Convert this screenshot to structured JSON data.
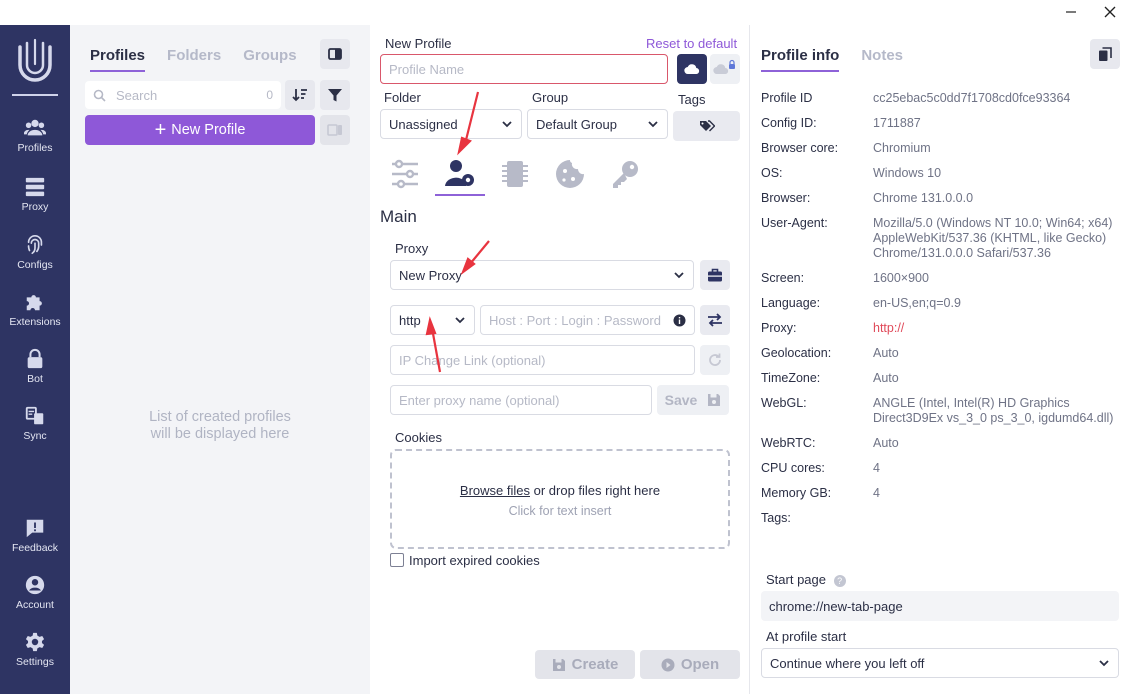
{
  "window": {
    "minimize_icon": "minimize-icon",
    "close_icon": "close-icon"
  },
  "nav": {
    "items": [
      {
        "label": "Profiles",
        "icon": "users-icon"
      },
      {
        "label": "Proxy",
        "icon": "server-icon"
      },
      {
        "label": "Configs",
        "icon": "fingerprint-icon"
      },
      {
        "label": "Extensions",
        "icon": "puzzle-icon"
      },
      {
        "label": "Bot",
        "icon": "lock-icon"
      },
      {
        "label": "Sync",
        "icon": "sync-icon"
      },
      {
        "label": "Feedback",
        "icon": "feedback-icon"
      },
      {
        "label": "Account",
        "icon": "account-icon"
      },
      {
        "label": "Settings",
        "icon": "settings-icon"
      }
    ]
  },
  "profiles_panel": {
    "tabs": [
      "Profiles",
      "Folders",
      "Groups"
    ],
    "search_placeholder": "Search",
    "count": "0",
    "new_profile_label": "New Profile",
    "empty_line1": "List of created profiles",
    "empty_line2": "will be displayed here"
  },
  "form": {
    "title": "New Profile",
    "reset_label": "Reset to default",
    "name_placeholder": "Profile Name",
    "folder_label": "Folder",
    "folder_value": "Unassigned",
    "group_label": "Group",
    "group_value": "Default Group",
    "tags_label": "Tags",
    "section_title": "Main",
    "proxy_label": "Proxy",
    "proxy_value": "New Proxy",
    "protocol_value": "http",
    "host_placeholder": "Host : Port : Login : Password",
    "ip_change_placeholder": "IP Change Link (optional)",
    "proxy_name_placeholder": "Enter proxy name (optional)",
    "save_label": "Save",
    "cookies_label": "Cookies",
    "browse_label": "Browse files",
    "drop_label": " or drop files right here",
    "click_label": "Click for text insert",
    "import_expired_label": "Import expired cookies",
    "create_label": "Create",
    "open_label": "Open"
  },
  "info": {
    "tabs": [
      "Profile info",
      "Notes"
    ],
    "rows": [
      {
        "k": "Profile ID",
        "v": "cc25ebac5c0dd7f1708cd0fce93364"
      },
      {
        "k": "Config ID:",
        "v": "1711887"
      },
      {
        "k": "Browser core:",
        "v": "Chromium"
      },
      {
        "k": "OS:",
        "v": "Windows 10"
      },
      {
        "k": "Browser:",
        "v": "Chrome 131.0.0.0"
      },
      {
        "k": "User-Agent:",
        "v": "Mozilla/5.0 (Windows NT 10.0; Win64; x64) AppleWebKit/537.36 (KHTML, like Gecko) Chrome/131.0.0.0 Safari/537.36"
      },
      {
        "k": "Screen:",
        "v": "1600×900"
      },
      {
        "k": "Language:",
        "v": "en-US,en;q=0.9"
      },
      {
        "k": "Proxy:",
        "v": "http://"
      },
      {
        "k": "Geolocation:",
        "v": "Auto"
      },
      {
        "k": "TimeZone:",
        "v": "Auto"
      },
      {
        "k": "WebGL:",
        "v": "ANGLE (Intel, Intel(R) HD Graphics Direct3D9Ex vs_3_0 ps_3_0, igdumd64.dll)"
      },
      {
        "k": "WebRTC:",
        "v": "Auto"
      },
      {
        "k": "CPU cores:",
        "v": "4"
      },
      {
        "k": "Memory GB:",
        "v": "4"
      },
      {
        "k": "Tags:",
        "v": ""
      }
    ],
    "start_page_label": "Start page",
    "start_page_value": "chrome://new-tab-page",
    "at_start_label": "At profile start",
    "at_start_value": "Continue where you left off"
  },
  "colors": {
    "nav_bg": "#2e3463",
    "accent": "#8e58d8",
    "error": "#d9576b",
    "proxy_value": "#e04a5a"
  }
}
